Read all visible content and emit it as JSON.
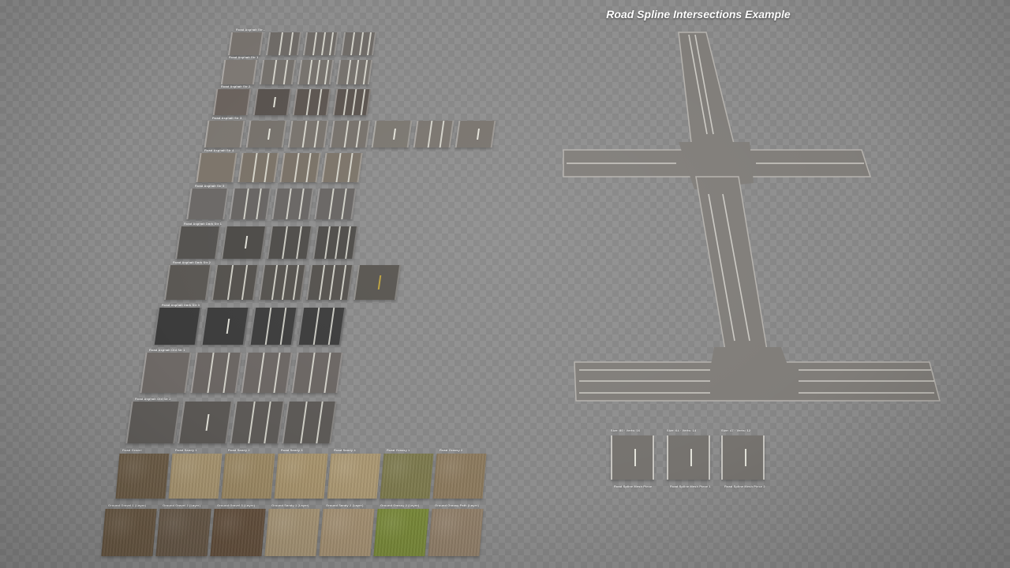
{
  "viewport_title": "Road Spline Intersections Example",
  "road_rows": [
    {
      "label": "Road Asphalt Str...",
      "tiles": [
        {
          "style": "plain",
          "color": "#77726d"
        },
        {
          "style": "lanes2",
          "color": "#6e6a66"
        },
        {
          "style": "lanes3",
          "color": "#6f6b67"
        },
        {
          "style": "lanes3",
          "color": "#6e6a66"
        }
      ]
    },
    {
      "label": "Road Asphalt Str 1",
      "tiles": [
        {
          "style": "plain",
          "color": "#7d7873"
        },
        {
          "style": "lanes2",
          "color": "#75716c"
        },
        {
          "style": "lanes3",
          "color": "#76726d"
        },
        {
          "style": "lanes3",
          "color": "#75716c"
        }
      ]
    },
    {
      "label": "Road Asphalt Str 2",
      "tiles": [
        {
          "style": "plain",
          "color": "#6a625d"
        },
        {
          "style": "dash",
          "color": "#58524e"
        },
        {
          "style": "lanes2",
          "color": "#5c5550"
        },
        {
          "style": "lanes3",
          "color": "#5a534e"
        }
      ]
    },
    {
      "label": "Road Asphalt Str 3",
      "tiles": [
        {
          "style": "plain",
          "color": "#7b7670"
        },
        {
          "style": "dash",
          "color": "#76716b"
        },
        {
          "style": "lanes2",
          "color": "#78736d"
        },
        {
          "style": "lanes2",
          "color": "#76716b"
        },
        {
          "style": "dash",
          "color": "#7a766f"
        },
        {
          "style": "lanes2",
          "color": "#79746e"
        },
        {
          "style": "dash",
          "color": "#78736d"
        }
      ]
    },
    {
      "label": "Road Asphalt Str 4",
      "tiles": [
        {
          "style": "plain",
          "color": "#7c746a"
        },
        {
          "style": "lanes2",
          "color": "#7a7267"
        },
        {
          "style": "lanes2",
          "color": "#797166"
        },
        {
          "style": "lanes2",
          "color": "#7b7368"
        }
      ]
    },
    {
      "label": "Road Asphalt Str 5",
      "tiles": [
        {
          "style": "plain",
          "color": "#6b6866"
        },
        {
          "style": "lanes2",
          "color": "#676462"
        },
        {
          "style": "lanes2",
          "color": "#686563"
        },
        {
          "style": "lanes2",
          "color": "#676462"
        }
      ]
    },
    {
      "label": "Road Asphalt Dark Str 1",
      "tiles": [
        {
          "style": "plain",
          "color": "#54524f"
        },
        {
          "style": "dash",
          "color": "#4c4a47"
        },
        {
          "style": "lanes2",
          "color": "#4e4c49"
        },
        {
          "style": "lanes3",
          "color": "#4d4b48"
        }
      ]
    },
    {
      "label": "Road Asphalt Dark Str 2",
      "tiles": [
        {
          "style": "plain",
          "color": "#5a5753"
        },
        {
          "style": "lanes2",
          "color": "#54514d"
        },
        {
          "style": "lanes3",
          "color": "#55524e"
        },
        {
          "style": "lanes3",
          "color": "#54514d"
        },
        {
          "style": "yellow",
          "color": "#57544f"
        }
      ]
    },
    {
      "label": "Road Asphalt Dark Str 3",
      "tiles": [
        {
          "style": "plain",
          "color": "#3b3b3b"
        },
        {
          "style": "dash",
          "color": "#3c3c3c"
        },
        {
          "style": "lanes2",
          "color": "#3d3d3d"
        },
        {
          "style": "lanes2",
          "color": "#3c3c3c"
        }
      ]
    },
    {
      "label": "Road Asphalt Old Str 1",
      "tiles": [
        {
          "style": "plain",
          "color": "#6e6966"
        },
        {
          "style": "lanes2",
          "color": "#6b6663"
        },
        {
          "style": "lanes2",
          "color": "#6c6764"
        },
        {
          "style": "lanes2",
          "color": "#6b6663"
        }
      ]
    },
    {
      "label": "Road Asphalt Old Str 2",
      "tiles": [
        {
          "style": "plain",
          "color": "#5f5c59"
        },
        {
          "style": "dash",
          "color": "#5b5855"
        },
        {
          "style": "lanes2",
          "color": "#5d5a57"
        },
        {
          "style": "lanes2",
          "color": "#5c5956"
        }
      ]
    }
  ],
  "surface_rows": [
    {
      "tiles": [
        {
          "label": "Road Gravel",
          "color": "#6e5e48"
        },
        {
          "label": "Road Sandy 1",
          "color": "#a99671"
        },
        {
          "label": "Road Sandy 2",
          "color": "#9d8a65"
        },
        {
          "label": "Road Sandy 3",
          "color": "#a8946d"
        },
        {
          "label": "Road Sandy 4",
          "color": "#ab9873"
        },
        {
          "label": "Road Grassy 1",
          "color": "#7d7a4e"
        },
        {
          "label": "Road Grassy 2",
          "color": "#8c7a5e"
        }
      ]
    },
    {
      "tiles": [
        {
          "label": "Ground Gravel 1 (Layer)",
          "color": "#6b5a45"
        },
        {
          "label": "Ground Gravel 2 (Layer)",
          "color": "#6a5b4a"
        },
        {
          "label": "Ground Gravel 3 (Layer)",
          "color": "#66523f"
        },
        {
          "label": "Ground Sandy 1 (Layer)",
          "color": "#a89677"
        },
        {
          "label": "Ground Sandy 2 (Layer)",
          "color": "#a69274"
        },
        {
          "label": "Ground Grassy 2 (Layer)",
          "color": "#7a8a3a"
        },
        {
          "label": "Ground Grassy Path (Layer)",
          "color": "#92806a"
        }
      ]
    }
  ],
  "spline_meshes": [
    {
      "top_label": "Size: 80 · Verts: 16",
      "bottom_label": "Road Spline Mesh Piece"
    },
    {
      "top_label": "Size: 64 · Verts: 14",
      "bottom_label": "Road Spline Mesh Piece 1"
    },
    {
      "top_label": "Size: 47 · Verts: 12",
      "bottom_label": "Road Spline Mesh Piece 2"
    }
  ],
  "colors": {
    "intersection_road": "#807d79",
    "intersection_edge": "#b5b2ad",
    "lane_marking": "#e6e4de"
  },
  "icons": [
    "road-tile-icon",
    "surface-tile-icon",
    "spline-mesh-icon"
  ]
}
